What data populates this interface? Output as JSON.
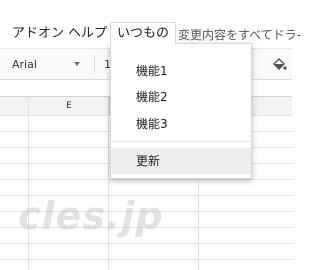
{
  "menubar": {
    "items": [
      "アドオン",
      "ヘルプ"
    ],
    "active_menu": "いつもの",
    "saved_note": "変更内容をすべてドラ-"
  },
  "toolbar": {
    "font": "Arial",
    "size": "1",
    "fill_icon": "paint-bucket-icon"
  },
  "sheet": {
    "column_e": "E"
  },
  "dropdown": {
    "items": [
      "機能1",
      "機能2",
      "機能3"
    ],
    "update_label": "更新"
  },
  "watermark": "cles.jp"
}
